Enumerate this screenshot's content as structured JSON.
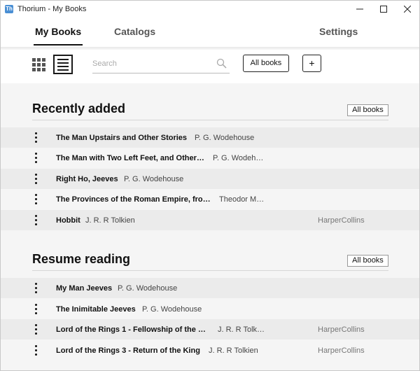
{
  "window": {
    "app_icon_glyph": "Th",
    "title": "Thorium - My Books"
  },
  "nav": {
    "tabs": [
      {
        "label": "My Books",
        "active": true
      },
      {
        "label": "Catalogs",
        "active": false
      },
      {
        "label": "Settings",
        "active": false
      }
    ]
  },
  "toolbar": {
    "search_placeholder": "Search",
    "all_books_label": "All books",
    "add_label": "+"
  },
  "sections": [
    {
      "title": "Recently added",
      "all_books_label": "All books",
      "rows": [
        {
          "title": "The Man Upstairs and Other Stories",
          "author": "P. G. Wodehouse",
          "publisher": ""
        },
        {
          "title": "The Man with Two Left Feet, and Other…",
          "author": "P. G. Wodeh…",
          "publisher": ""
        },
        {
          "title": "Right Ho, Jeeves",
          "author": "P. G. Wodehouse",
          "publisher": ""
        },
        {
          "title": "The Provinces of the Roman Empire, fro…",
          "author": "Theodor M…",
          "publisher": ""
        },
        {
          "title": "Hobbit",
          "author": "J. R. R Tolkien",
          "publisher": "HarperCollins"
        }
      ]
    },
    {
      "title": "Resume reading",
      "all_books_label": "All books",
      "rows": [
        {
          "title": "My Man Jeeves",
          "author": "P. G. Wodehouse",
          "publisher": ""
        },
        {
          "title": "The Inimitable Jeeves",
          "author": "P. G. Wodehouse",
          "publisher": ""
        },
        {
          "title": "Lord of the Rings 1 - Fellowship of the …",
          "author": "J. R. R Tolk…",
          "publisher": "HarperCollins"
        },
        {
          "title": "Lord of the Rings 3 - Return of the King",
          "author": "J. R. R Tolkien",
          "publisher": "HarperCollins"
        }
      ]
    }
  ],
  "icons": {
    "view_grid": "grid-icon",
    "view_list": "list-icon",
    "search": "search-icon",
    "menu": "vertical-dots-icon"
  },
  "colors": {
    "accent": "#111111",
    "shade_row": "#ebebeb",
    "background": "#f5f5f5"
  }
}
